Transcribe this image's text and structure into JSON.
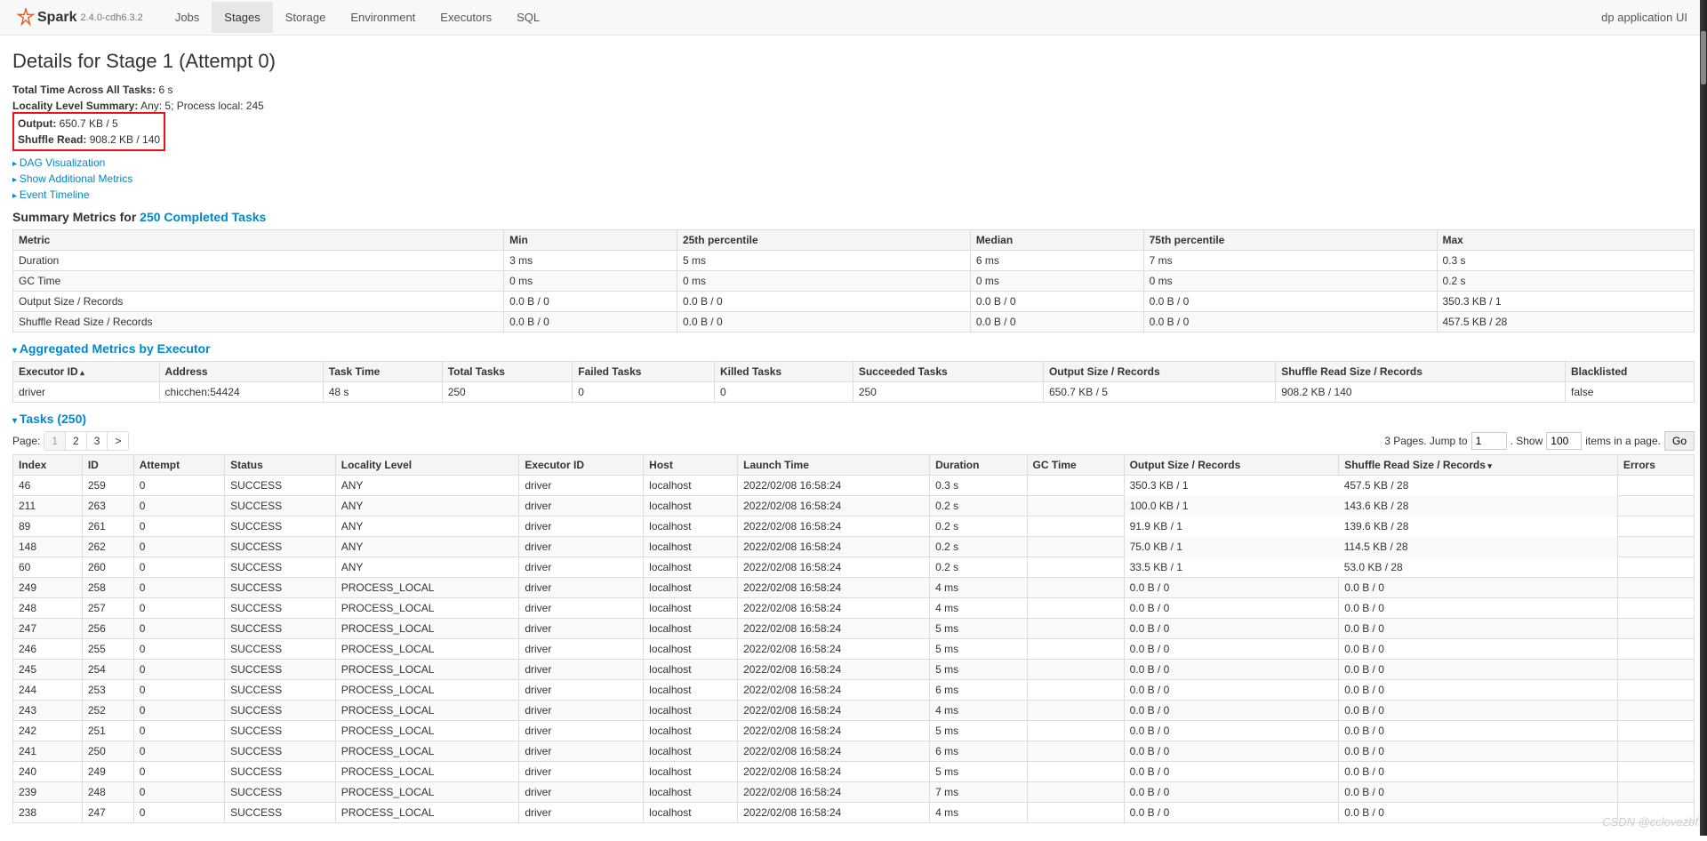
{
  "brand": "Spark",
  "version": "2.4.0-cdh6.3.2",
  "nav": {
    "tabs": [
      "Jobs",
      "Stages",
      "Storage",
      "Environment",
      "Executors",
      "SQL"
    ],
    "active": "Stages",
    "right": "dp application UI"
  },
  "title": "Details for Stage 1 (Attempt 0)",
  "kvs": {
    "total_time_label": "Total Time Across All Tasks:",
    "total_time": "6 s",
    "locality_label": "Locality Level Summary:",
    "locality": "Any: 5; Process local: 245",
    "output_label": "Output:",
    "output": "650.7 KB / 5",
    "shuffle_label": "Shuffle Read:",
    "shuffle": "908.2 KB / 140"
  },
  "links": {
    "dag": "DAG Visualization",
    "metrics": "Show Additional Metrics",
    "timeline": "Event Timeline"
  },
  "summary_title_pre": "Summary Metrics for ",
  "summary_title_link": "250 Completed Tasks",
  "summary": {
    "headers": [
      "Metric",
      "Min",
      "25th percentile",
      "Median",
      "75th percentile",
      "Max"
    ],
    "rows": [
      [
        "Duration",
        "3 ms",
        "5 ms",
        "6 ms",
        "7 ms",
        "0.3 s"
      ],
      [
        "GC Time",
        "0 ms",
        "0 ms",
        "0 ms",
        "0 ms",
        "0.2 s"
      ],
      [
        "Output Size / Records",
        "0.0 B / 0",
        "0.0 B / 0",
        "0.0 B / 0",
        "0.0 B / 0",
        "350.3 KB / 1"
      ],
      [
        "Shuffle Read Size / Records",
        "0.0 B / 0",
        "0.0 B / 0",
        "0.0 B / 0",
        "0.0 B / 0",
        "457.5 KB / 28"
      ]
    ]
  },
  "agg_title": "Aggregated Metrics by Executor",
  "agg": {
    "headers": [
      "Executor ID",
      "Address",
      "Task Time",
      "Total Tasks",
      "Failed Tasks",
      "Killed Tasks",
      "Succeeded Tasks",
      "Output Size / Records",
      "Shuffle Read Size / Records",
      "Blacklisted"
    ],
    "row": [
      "driver",
      "chicchen:54424",
      "48 s",
      "250",
      "0",
      "0",
      "250",
      "650.7 KB / 5",
      "908.2 KB / 140",
      "false"
    ]
  },
  "tasks_title": "Tasks (250)",
  "pagination": {
    "page_label": "Page:",
    "pages": [
      "1",
      "2",
      "3",
      ">"
    ],
    "info": "3 Pages. Jump to",
    "jump": "1",
    "show_label": ". Show",
    "show": "100",
    "suffix": "items in a page.",
    "go": "Go"
  },
  "tasks": {
    "headers": [
      "Index",
      "ID",
      "Attempt",
      "Status",
      "Locality Level",
      "Executor ID",
      "Host",
      "Launch Time",
      "Duration",
      "GC Time",
      "Output Size / Records",
      "Shuffle Read Size / Records",
      "Errors"
    ],
    "sort_col": 11,
    "rows": [
      [
        "46",
        "259",
        "0",
        "SUCCESS",
        "ANY",
        "driver",
        "localhost",
        "2022/02/08 16:58:24",
        "0.3 s",
        "",
        "350.3 KB / 1",
        "457.5 KB / 28",
        ""
      ],
      [
        "211",
        "263",
        "0",
        "SUCCESS",
        "ANY",
        "driver",
        "localhost",
        "2022/02/08 16:58:24",
        "0.2 s",
        "",
        "100.0 KB / 1",
        "143.6 KB / 28",
        ""
      ],
      [
        "89",
        "261",
        "0",
        "SUCCESS",
        "ANY",
        "driver",
        "localhost",
        "2022/02/08 16:58:24",
        "0.2 s",
        "",
        "91.9 KB / 1",
        "139.6 KB / 28",
        ""
      ],
      [
        "148",
        "262",
        "0",
        "SUCCESS",
        "ANY",
        "driver",
        "localhost",
        "2022/02/08 16:58:24",
        "0.2 s",
        "",
        "75.0 KB / 1",
        "114.5 KB / 28",
        ""
      ],
      [
        "60",
        "260",
        "0",
        "SUCCESS",
        "ANY",
        "driver",
        "localhost",
        "2022/02/08 16:58:24",
        "0.2 s",
        "",
        "33.5 KB / 1",
        "53.0 KB / 28",
        ""
      ],
      [
        "249",
        "258",
        "0",
        "SUCCESS",
        "PROCESS_LOCAL",
        "driver",
        "localhost",
        "2022/02/08 16:58:24",
        "4 ms",
        "",
        "0.0 B / 0",
        "0.0 B / 0",
        ""
      ],
      [
        "248",
        "257",
        "0",
        "SUCCESS",
        "PROCESS_LOCAL",
        "driver",
        "localhost",
        "2022/02/08 16:58:24",
        "4 ms",
        "",
        "0.0 B / 0",
        "0.0 B / 0",
        ""
      ],
      [
        "247",
        "256",
        "0",
        "SUCCESS",
        "PROCESS_LOCAL",
        "driver",
        "localhost",
        "2022/02/08 16:58:24",
        "5 ms",
        "",
        "0.0 B / 0",
        "0.0 B / 0",
        ""
      ],
      [
        "246",
        "255",
        "0",
        "SUCCESS",
        "PROCESS_LOCAL",
        "driver",
        "localhost",
        "2022/02/08 16:58:24",
        "5 ms",
        "",
        "0.0 B / 0",
        "0.0 B / 0",
        ""
      ],
      [
        "245",
        "254",
        "0",
        "SUCCESS",
        "PROCESS_LOCAL",
        "driver",
        "localhost",
        "2022/02/08 16:58:24",
        "5 ms",
        "",
        "0.0 B / 0",
        "0.0 B / 0",
        ""
      ],
      [
        "244",
        "253",
        "0",
        "SUCCESS",
        "PROCESS_LOCAL",
        "driver",
        "localhost",
        "2022/02/08 16:58:24",
        "6 ms",
        "",
        "0.0 B / 0",
        "0.0 B / 0",
        ""
      ],
      [
        "243",
        "252",
        "0",
        "SUCCESS",
        "PROCESS_LOCAL",
        "driver",
        "localhost",
        "2022/02/08 16:58:24",
        "4 ms",
        "",
        "0.0 B / 0",
        "0.0 B / 0",
        ""
      ],
      [
        "242",
        "251",
        "0",
        "SUCCESS",
        "PROCESS_LOCAL",
        "driver",
        "localhost",
        "2022/02/08 16:58:24",
        "5 ms",
        "",
        "0.0 B / 0",
        "0.0 B / 0",
        ""
      ],
      [
        "241",
        "250",
        "0",
        "SUCCESS",
        "PROCESS_LOCAL",
        "driver",
        "localhost",
        "2022/02/08 16:58:24",
        "6 ms",
        "",
        "0.0 B / 0",
        "0.0 B / 0",
        ""
      ],
      [
        "240",
        "249",
        "0",
        "SUCCESS",
        "PROCESS_LOCAL",
        "driver",
        "localhost",
        "2022/02/08 16:58:24",
        "5 ms",
        "",
        "0.0 B / 0",
        "0.0 B / 0",
        ""
      ],
      [
        "239",
        "248",
        "0",
        "SUCCESS",
        "PROCESS_LOCAL",
        "driver",
        "localhost",
        "2022/02/08 16:58:24",
        "7 ms",
        "",
        "0.0 B / 0",
        "0.0 B / 0",
        ""
      ],
      [
        "238",
        "247",
        "0",
        "SUCCESS",
        "PROCESS_LOCAL",
        "driver",
        "localhost",
        "2022/02/08 16:58:24",
        "4 ms",
        "",
        "0.0 B / 0",
        "0.0 B / 0",
        ""
      ]
    ],
    "highlight_rows": 5
  },
  "watermark": "CSDN @cclovezbf"
}
